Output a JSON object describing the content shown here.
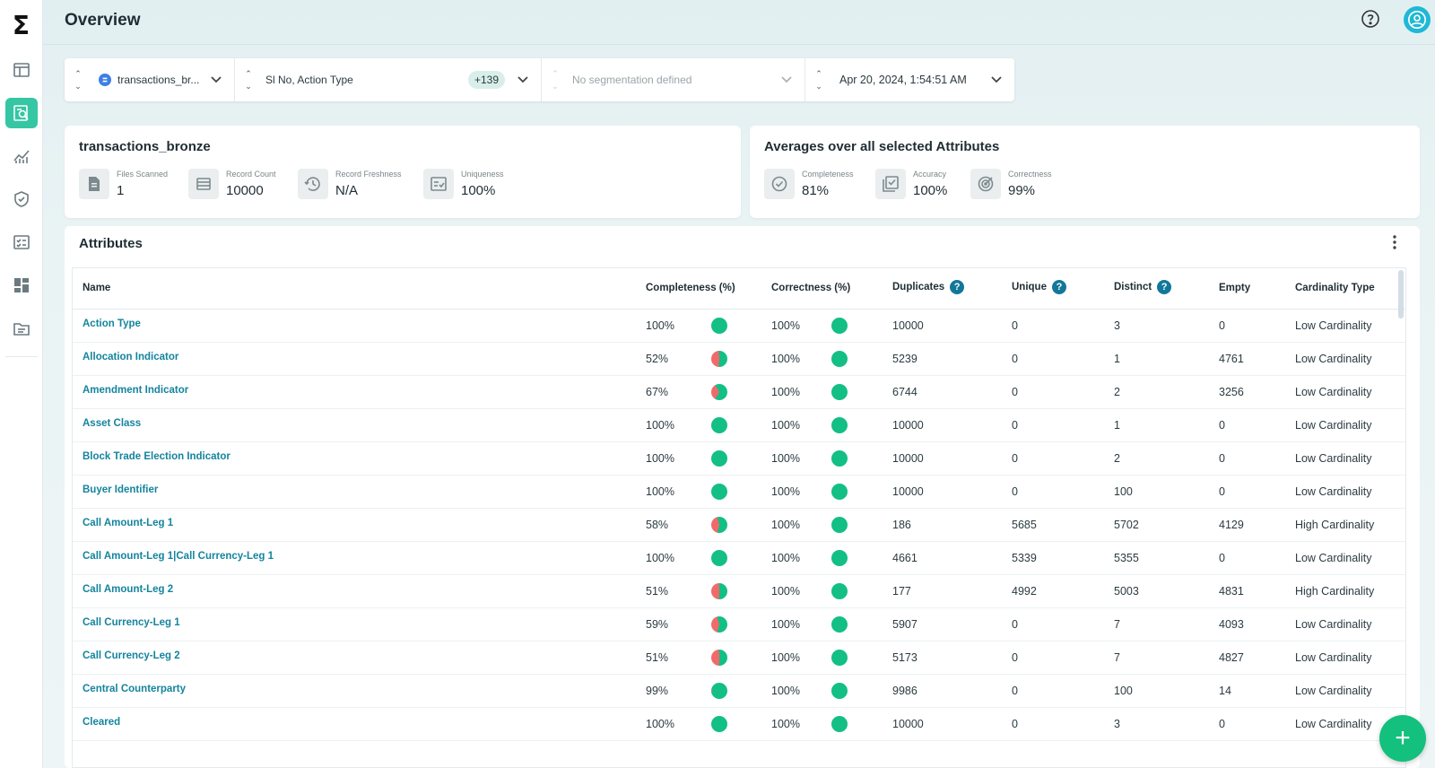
{
  "app": {
    "logo": "Σ"
  },
  "header": {
    "title": "Overview"
  },
  "filters": {
    "dataset": "transactions_br...",
    "attributes": "Sl No, Action Type",
    "attributes_more": "+139",
    "segmentation_placeholder": "No segmentation defined",
    "date": "Apr 20, 2024, 1:54:51 AM"
  },
  "summary": {
    "title": "transactions_bronze",
    "metrics": [
      {
        "label": "Files Scanned",
        "value": "1",
        "icon": "document-icon"
      },
      {
        "label": "Record Count",
        "value": "10000",
        "icon": "list-icon"
      },
      {
        "label": "Record Freshness",
        "value": "N/A",
        "icon": "history-icon"
      },
      {
        "label": "Uniqueness",
        "value": "100%",
        "icon": "checklist-icon"
      }
    ]
  },
  "averages": {
    "title": "Averages over all selected Attributes",
    "metrics": [
      {
        "label": "Completeness",
        "value": "81%",
        "icon": "check-circle-icon"
      },
      {
        "label": "Accuracy",
        "value": "100%",
        "icon": "check-box-icon"
      },
      {
        "label": "Correctness",
        "value": "99%",
        "icon": "target-icon"
      }
    ]
  },
  "attributes": {
    "title": "Attributes",
    "columns": [
      "Name",
      "Completeness (%)",
      "Correctness (%)",
      "Duplicates",
      "Unique",
      "Distinct",
      "Empty",
      "Cardinality Type"
    ],
    "help_mark": "?",
    "rows": [
      {
        "name": "Action Type",
        "completeness": "100%",
        "comp_fill": 1.0,
        "correctness": "100%",
        "corr_fill": 1.0,
        "duplicates": "10000",
        "unique": "0",
        "distinct": "3",
        "empty": "0",
        "cardinality": "Low Cardinality"
      },
      {
        "name": "Allocation Indicator",
        "completeness": "52%",
        "comp_fill": 0.52,
        "correctness": "100%",
        "corr_fill": 1.0,
        "duplicates": "5239",
        "unique": "0",
        "distinct": "1",
        "empty": "4761",
        "cardinality": "Low Cardinality"
      },
      {
        "name": "Amendment Indicator",
        "completeness": "67%",
        "comp_fill": 0.67,
        "correctness": "100%",
        "corr_fill": 1.0,
        "duplicates": "6744",
        "unique": "0",
        "distinct": "2",
        "empty": "3256",
        "cardinality": "Low Cardinality"
      },
      {
        "name": "Asset Class",
        "completeness": "100%",
        "comp_fill": 1.0,
        "correctness": "100%",
        "corr_fill": 1.0,
        "duplicates": "10000",
        "unique": "0",
        "distinct": "1",
        "empty": "0",
        "cardinality": "Low Cardinality"
      },
      {
        "name": "Block Trade Election Indicator",
        "completeness": "100%",
        "comp_fill": 1.0,
        "correctness": "100%",
        "corr_fill": 1.0,
        "duplicates": "10000",
        "unique": "0",
        "distinct": "2",
        "empty": "0",
        "cardinality": "Low Cardinality"
      },
      {
        "name": "Buyer Identifier",
        "completeness": "100%",
        "comp_fill": 1.0,
        "correctness": "100%",
        "corr_fill": 1.0,
        "duplicates": "10000",
        "unique": "0",
        "distinct": "100",
        "empty": "0",
        "cardinality": "Low Cardinality"
      },
      {
        "name": "Call Amount-Leg 1",
        "completeness": "58%",
        "comp_fill": 0.58,
        "correctness": "100%",
        "corr_fill": 1.0,
        "duplicates": "186",
        "unique": "5685",
        "distinct": "5702",
        "empty": "4129",
        "cardinality": "High Cardinality"
      },
      {
        "name": "Call Amount-Leg 1|Call Currency-Leg 1",
        "completeness": "100%",
        "comp_fill": 1.0,
        "correctness": "100%",
        "corr_fill": 1.0,
        "duplicates": "4661",
        "unique": "5339",
        "distinct": "5355",
        "empty": "0",
        "cardinality": "Low Cardinality"
      },
      {
        "name": "Call Amount-Leg 2",
        "completeness": "51%",
        "comp_fill": 0.51,
        "correctness": "100%",
        "corr_fill": 1.0,
        "duplicates": "177",
        "unique": "4992",
        "distinct": "5003",
        "empty": "4831",
        "cardinality": "High Cardinality"
      },
      {
        "name": "Call Currency-Leg 1",
        "completeness": "59%",
        "comp_fill": 0.59,
        "correctness": "100%",
        "corr_fill": 1.0,
        "duplicates": "5907",
        "unique": "0",
        "distinct": "7",
        "empty": "4093",
        "cardinality": "Low Cardinality"
      },
      {
        "name": "Call Currency-Leg 2",
        "completeness": "51%",
        "comp_fill": 0.51,
        "correctness": "100%",
        "corr_fill": 1.0,
        "duplicates": "5173",
        "unique": "0",
        "distinct": "7",
        "empty": "4827",
        "cardinality": "Low Cardinality"
      },
      {
        "name": "Central Counterparty",
        "completeness": "99%",
        "comp_fill": 0.99,
        "correctness": "100%",
        "corr_fill": 1.0,
        "duplicates": "9986",
        "unique": "0",
        "distinct": "100",
        "empty": "14",
        "cardinality": "Low Cardinality"
      },
      {
        "name": "Cleared",
        "completeness": "100%",
        "comp_fill": 1.0,
        "correctness": "100%",
        "corr_fill": 1.0,
        "duplicates": "10000",
        "unique": "0",
        "distinct": "3",
        "empty": "0",
        "cardinality": "Low Cardinality"
      }
    ]
  },
  "colors": {
    "good": "#13bf84",
    "bad": "#ef6b6b",
    "link": "#14849e",
    "accent": "#35c6a3"
  },
  "fab": {
    "label": "+"
  }
}
